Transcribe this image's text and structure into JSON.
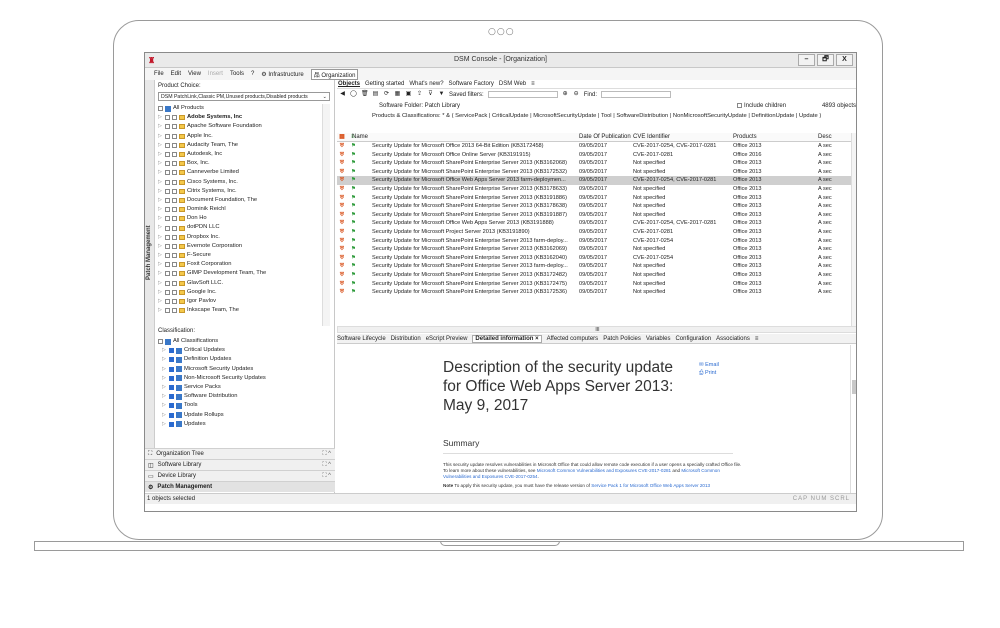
{
  "window": {
    "title": "DSM Console - [Organization]",
    "buttons": [
      "–",
      "🗗",
      "X"
    ]
  },
  "menu": {
    "items": [
      "File",
      "Edit",
      "View",
      "Insert",
      "Tools",
      "?",
      "Infrastructure",
      "Organization"
    ],
    "disabled": "Insert"
  },
  "left": {
    "side_tab": "Patch Management",
    "product_choice_label": "Product Choice:",
    "product_choice_value": "DSM PatchLink,Classic PM,Unused products,Disabled products",
    "products": [
      "All Products",
      "Adobe Systems, Inc",
      "Apache Software Foundation",
      "Apple Inc.",
      "Audacity Team, The",
      "Autodesk, Inc",
      "Box, Inc.",
      "Canneverbe Limited",
      "Cisco Systems, Inc.",
      "Citrix Systems, Inc.",
      "Document Foundation, The",
      "Dominik Reichl",
      "Don Ho",
      "dotPDN LLC",
      "Dropbox Inc.",
      "Evernote Corporation",
      "F-Secure",
      "Foxit Corporation",
      "GIMP Development Team, The",
      "GlavSoft LLC.",
      "Google Inc.",
      "Igor Pavlov",
      "Inkscape Team, The"
    ],
    "classification_label": "Classification:",
    "classifications": [
      "All Classifications",
      "Critical Updates",
      "Definition Updates",
      "Microsoft Security Updates",
      "Non-Microsoft Security Updates",
      "Service Packs",
      "Software Distribution",
      "Tools",
      "Update Rollups",
      "Updates"
    ],
    "nav": [
      "Organization Tree",
      "Software Library",
      "Device Library",
      "Patch Management"
    ]
  },
  "status": {
    "text": "1 objects selected",
    "keys": "CAP  NUM  SCRL"
  },
  "right": {
    "tabs": [
      "Objects",
      "Getting started",
      "What's new?",
      "Software Factory",
      "DSM Web",
      "≡"
    ],
    "saved_filters_label": "Saved filters:",
    "find_label": "Find:",
    "software_folder": "Software Folder: Patch Library",
    "include_children": "Include children",
    "object_count": "4893 objects",
    "products_classifications": "Products & Classifications: * & ( ServicePack | CriticalUpdate | MicrosoftSecurityUpdate | Tool | SoftwareDistribution | NonMicrosoftSecurityUpdate | DefinitionUpdate | Update )",
    "columns": [
      "Name",
      "Date Of Publication",
      "CVE Identifier",
      "Products",
      "Desc"
    ],
    "rows": [
      {
        "name": "Security Update for Microsoft Office 2013 64-Bit Edition (KB3172458)",
        "date": "09/05/2017",
        "cve": "CVE-2017-0254, CVE-2017-0281",
        "product": "Office 2013",
        "desc": "A sec"
      },
      {
        "name": "Security Update for Microsoft Office Online Server (KB3191915)",
        "date": "09/05/2017",
        "cve": "CVE-2017-0281",
        "product": "Office 2016",
        "desc": "A sec"
      },
      {
        "name": "Security Update for Microsoft SharePoint Enterprise Server 2013 (KB3162068)",
        "date": "09/05/2017",
        "cve": "Not specified",
        "product": "Office 2013",
        "desc": "A sec"
      },
      {
        "name": "Security Update for Microsoft SharePoint Enterprise Server 2013 (KB3172532)",
        "date": "09/05/2017",
        "cve": "Not specified",
        "product": "Office 2013",
        "desc": "A sec"
      },
      {
        "name": "Security Update for Microsoft Office Web Apps Server 2013 farm-deploymen...",
        "date": "09/05/2017",
        "cve": "CVE-2017-0254, CVE-2017-0281",
        "product": "Office 2013",
        "desc": "A sec",
        "selected": true
      },
      {
        "name": "Security Update for Microsoft SharePoint Enterprise Server 2013 (KB3178633)",
        "date": "09/05/2017",
        "cve": "Not specified",
        "product": "Office 2013",
        "desc": "A sec"
      },
      {
        "name": "Security Update for Microsoft SharePoint Enterprise Server 2013 (KB3191886)",
        "date": "09/05/2017",
        "cve": "Not specified",
        "product": "Office 2013",
        "desc": "A sec"
      },
      {
        "name": "Security Update for Microsoft SharePoint Enterprise Server 2013 (KB3178638)",
        "date": "09/05/2017",
        "cve": "Not specified",
        "product": "Office 2013",
        "desc": "A sec"
      },
      {
        "name": "Security Update for Microsoft SharePoint Enterprise Server 2013 (KB3191887)",
        "date": "09/05/2017",
        "cve": "Not specified",
        "product": "Office 2013",
        "desc": "A sec"
      },
      {
        "name": "Security Update for Microsoft Office Web Apps Server 2013 (KB3191888)",
        "date": "09/05/2017",
        "cve": "CVE-2017-0254, CVE-2017-0281",
        "product": "Office 2013",
        "desc": "A sec"
      },
      {
        "name": "Security Update for Microsoft Project Server 2013 (KB3191890)",
        "date": "09/05/2017",
        "cve": "CVE-2017-0281",
        "product": "Office 2013",
        "desc": "A sec"
      },
      {
        "name": "Security Update for Microsoft SharePoint Enterprise Server 2013 farm-deploy...",
        "date": "09/05/2017",
        "cve": "CVE-2017-0254",
        "product": "Office 2013",
        "desc": "A sec"
      },
      {
        "name": "Security Update for Microsoft SharePoint Enterprise Server 2013 (KB3162069)",
        "date": "09/05/2017",
        "cve": "Not specified",
        "product": "Office 2013",
        "desc": "A sec"
      },
      {
        "name": "Security Update for Microsoft SharePoint Enterprise Server 2013 (KB3162040)",
        "date": "09/05/2017",
        "cve": "CVE-2017-0254",
        "product": "Office 2013",
        "desc": "A sec"
      },
      {
        "name": "Security Update for Microsoft SharePoint Enterprise Server 2013 farm-deploy...",
        "date": "09/05/2017",
        "cve": "Not specified",
        "product": "Office 2013",
        "desc": "A sec"
      },
      {
        "name": "Security Update for Microsoft SharePoint Enterprise Server 2013 (KB3172482)",
        "date": "09/05/2017",
        "cve": "Not specified",
        "product": "Office 2013",
        "desc": "A sec"
      },
      {
        "name": "Security Update for Microsoft SharePoint Enterprise Server 2013 (KB3172475)",
        "date": "09/05/2017",
        "cve": "Not specified",
        "product": "Office 2013",
        "desc": "A sec"
      },
      {
        "name": "Security Update for Microsoft SharePoint Enterprise Server 2013 (KB3172536)",
        "date": "09/05/2017",
        "cve": "Not specified",
        "product": "Office 2013",
        "desc": "A sec"
      }
    ],
    "hscroll_mark": "III",
    "bottom_tabs": [
      "Software Lifecycle",
      "Distribution",
      "eScript Preview",
      "Detailed information ×",
      "Affected computers",
      "Patch Policies",
      "Variables",
      "Configuration",
      "Associations",
      "≡"
    ],
    "doc": {
      "title": "Description of the security update for Office Web Apps Server 2013: May 9, 2017",
      "email": "Email",
      "print": "Print",
      "summary": "Summary",
      "p1_a": "This security update resolves vulnerabilities in Microsoft Office that could allow remote code execution if a user opens a specially crafted Office file. To learn more about these vulnerabilities, see ",
      "p1_link": "Microsoft Common Vulnerabilities and Exposures CVE-2017-0281",
      "p1_b": " and ",
      "p1_link2": "Microsoft Common Vulnerabilities and Exposures CVE-2017-0254",
      "p1_c": ".",
      "p2_a": "Note",
      "p2_b": " To apply this security update, you must have the release version of ",
      "p2_link": "Service Pack 1 for Microsoft Office Web Apps Server 2013"
    }
  },
  "colors": {
    "accent": "#2a6ad0",
    "shield": "#d9531e",
    "selection": "#cfcfcf"
  }
}
